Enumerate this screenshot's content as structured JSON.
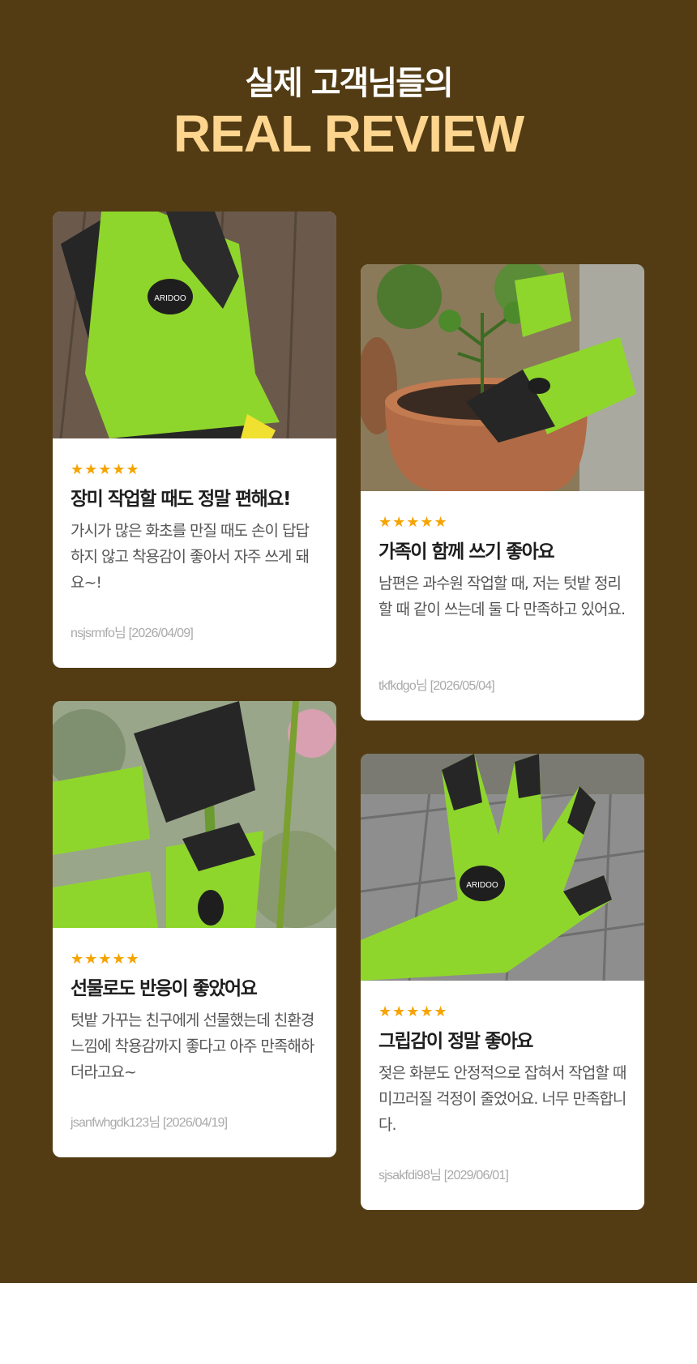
{
  "header": {
    "subtitle": "실제 고객님들의",
    "title": "REAL REVIEW"
  },
  "colors": {
    "background": "#533c14",
    "title_accent": "#fdd58f",
    "star": "#f5a400",
    "glove_green": "#8fd62c"
  },
  "reviews": [
    {
      "stars": "★★★★★",
      "title": "장미 작업할 때도 정말 편해요!",
      "text": "가시가 많은 화초를 만질 때도 손이 답답하지 않고 착용감이 좋아서 자주 쓰게 돼요~!",
      "author": "nsjsrmfo님",
      "date": "[2026/04/09]",
      "photo": "glove-on-wooden-bench"
    },
    {
      "stars": "★★★★★",
      "title": "가족이 함께 쓰기 좋아요",
      "text": "남편은 과수원 작업할 때, 저는 텃밭 정리할 때 같이 쓰는데 둘 다 만족하고 있어요.",
      "author": "tkfkdgo님",
      "date": "[2026/05/04]",
      "photo": "glove-planting-tomato-in-pot"
    },
    {
      "stars": "★★★★★",
      "title": "선물로도 반응이 좋았어요",
      "text": "텃밭 가꾸는 친구에게 선물했는데 친환경 느낌에 착용감까지 좋다고 아주 만족해하더라고요~",
      "author": "jsanfwhgdk123님",
      "date": "[2026/04/19]",
      "photo": "gloves-holding-rose-stem"
    },
    {
      "stars": "★★★★★",
      "title": "그립감이 정말 좋아요",
      "text": "젖은 화분도 안정적으로 잡혀서 작업할 때 미끄러질 걱정이 줄었어요. 너무 만족합니다.",
      "author": "sjsakfdi98님",
      "date": "[2029/06/01]",
      "photo": "glove-on-stone-tiles"
    }
  ],
  "brand_badge": "ARIDOO"
}
